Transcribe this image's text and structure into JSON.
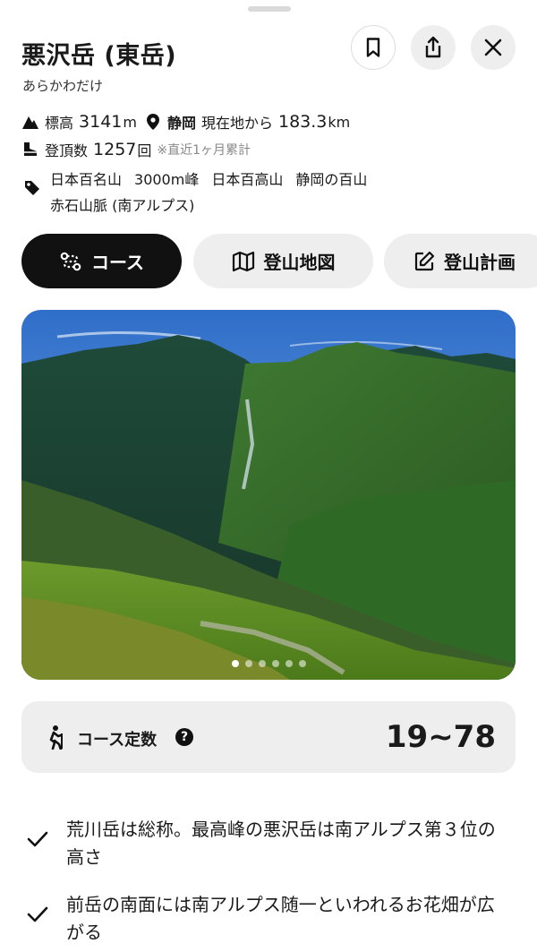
{
  "header": {
    "title": "悪沢岳 (東岳)",
    "reading": "あらかわだけ"
  },
  "stats": {
    "elevation_label": "標高",
    "elevation_value": "3141",
    "elevation_unit": "m",
    "prefecture": "静岡",
    "distance_prefix": "現在地から",
    "distance_value": "183.3",
    "distance_unit": "km",
    "climbs_label": "登頂数",
    "climbs_value": "1257",
    "climbs_unit": "回",
    "climbs_note": "※直近1ヶ月累計"
  },
  "tags": [
    "日本百名山",
    "3000m峰",
    "日本百高山",
    "静岡の百山",
    "赤石山脈 (南アルプス)"
  ],
  "tabs": {
    "course": "コース",
    "map": "登山地図",
    "plan": "登山計画"
  },
  "carousel": {
    "slide_count": 6,
    "active_index": 0
  },
  "course_constant": {
    "label": "コース定数",
    "help": "?",
    "value": "19~78"
  },
  "features": [
    "荒川岳は総称。最高峰の悪沢岳は南アルプス第３位の高さ",
    "前岳の南面には南アルプス随一といわれるお花畑が広がる"
  ],
  "colors": {
    "active_tab_bg": "#111111",
    "chip_bg": "#eeeeee",
    "text": "#1a1a1a"
  }
}
